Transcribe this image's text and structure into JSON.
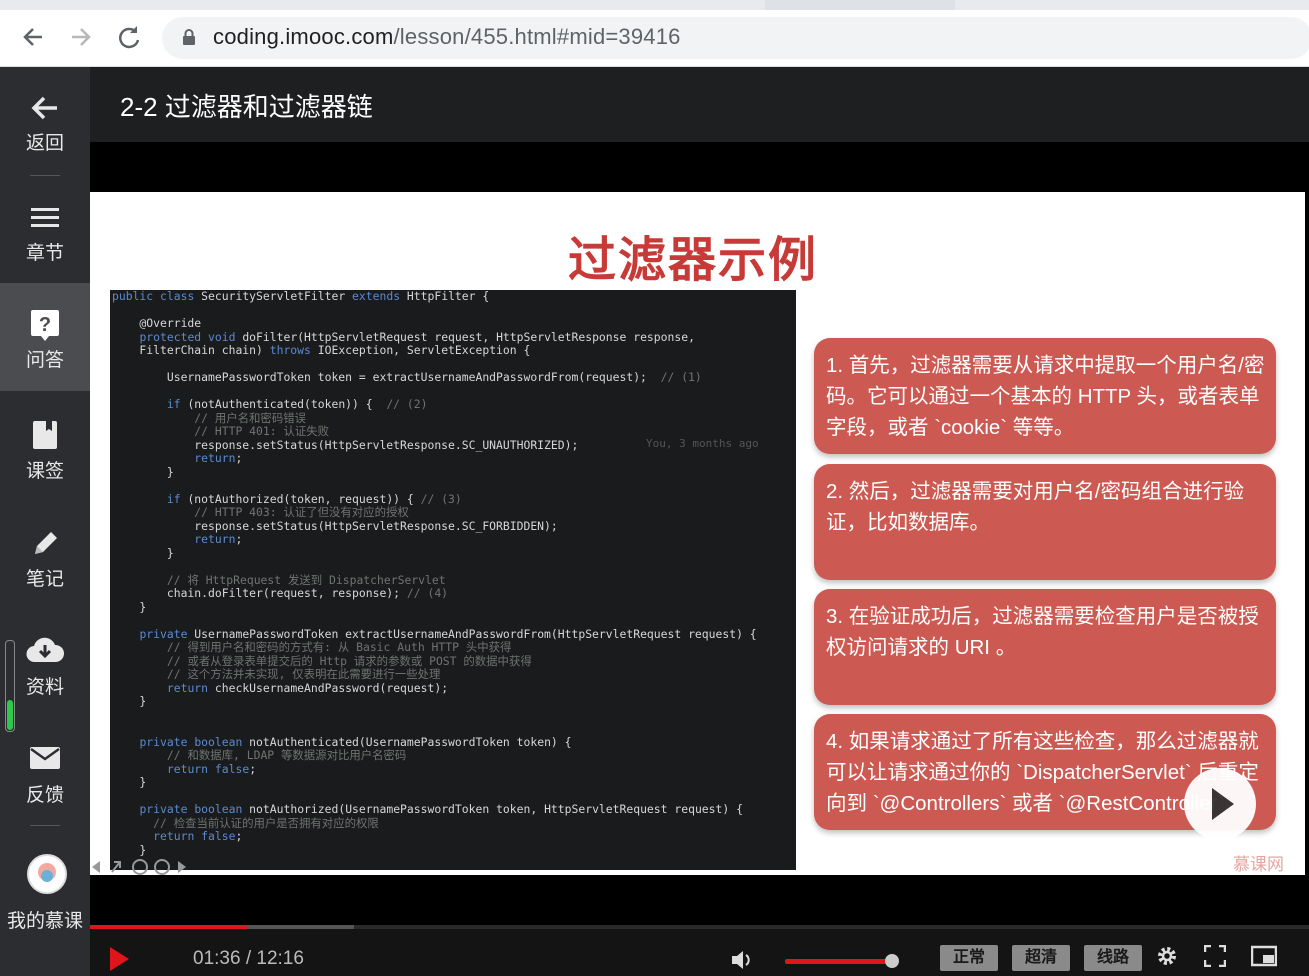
{
  "browser": {
    "url_host": "coding.imooc.com",
    "url_path": "/lesson/455.html#mid=39416"
  },
  "sidebar": {
    "items": [
      {
        "label": "返回",
        "icon": "back-arrow-icon"
      },
      {
        "label": "章节",
        "icon": "list-icon"
      },
      {
        "label": "问答",
        "icon": "question-icon"
      },
      {
        "label": "课签",
        "icon": "bookmark-icon"
      },
      {
        "label": "笔记",
        "icon": "pencil-icon"
      },
      {
        "label": "资料",
        "icon": "cloud-download-icon"
      },
      {
        "label": "反馈",
        "icon": "mail-icon"
      },
      {
        "label": "我的慕课",
        "icon": "avatar"
      }
    ],
    "active": "问答"
  },
  "header": {
    "title": "2-2 过滤器和过滤器链"
  },
  "slide": {
    "title": "过滤器示例",
    "code_lines": [
      "public class SecurityServletFilter extends HttpFilter {",
      "",
      "    @Override",
      "    protected void doFilter(HttpServletRequest request, HttpServletResponse response,",
      "    FilterChain chain) throws IOException, ServletException {",
      "",
      "        UsernamePasswordToken token = extractUsernameAndPasswordFrom(request);  // (1)",
      "",
      "        if (notAuthenticated(token)) {  // (2)",
      "            // 用户名和密码错误",
      "            // HTTP 401: 认证失败",
      "            response.setStatus(HttpServletResponse.SC_UNAUTHORIZED);",
      "            return;",
      "        }",
      "",
      "        if (notAuthorized(token, request)) { // (3)",
      "            // HTTP 403: 认证了但没有对应的授权",
      "            response.setStatus(HttpServletResponse.SC_FORBIDDEN);",
      "            return;",
      "        }",
      "",
      "        // 将 HttpRequest 发送到 DispatcherServlet",
      "        chain.doFilter(request, response); // (4)",
      "    }",
      "",
      "    private UsernamePasswordToken extractUsernameAndPasswordFrom(HttpServletRequest request) {",
      "        // 得到用户名和密码的方式有: 从 Basic Auth HTTP 头中获得",
      "        // 或者从登录表单提交后的 Http 请求的参数或 POST 的数据中获得",
      "        // 这个方法并未实现, 仅表明在此需要进行一些处理",
      "        return checkUsernameAndPassword(request);",
      "    }",
      "",
      "",
      "    private boolean notAuthenticated(UsernamePasswordToken token) {",
      "        // 和数据库, LDAP 等数据源对比用户名密码",
      "        return false;",
      "    }",
      "",
      "    private boolean notAuthorized(UsernamePasswordToken token, HttpServletRequest request) {",
      "      // 检查当前认证的用户是否拥有对应的权限",
      "      return false;",
      "    }"
    ],
    "blame": "You, 3 months ago",
    "bullets": [
      "1. 首先，过滤器需要从请求中提取一个用户名/密码。它可以通过一个基本的 HTTP 头，或者表单字段，或者 `cookie` 等等。",
      "2. 然后，过滤器需要对用户名/密码组合进行验证，比如数据库。",
      "3. 在验证成功后，过滤器需要检查用户是否被授权访问请求的 URI 。",
      "4. 如果请求通过了所有这些检查，那么过滤器就可以让请求通过你的 `DispatcherServlet` 后重定向到 `@Controllers` 或者 `@RestController`。"
    ],
    "watermark": "慕课网"
  },
  "player": {
    "time": "01:36 / 12:16",
    "progress": 0.13,
    "volume": 0.85,
    "buttons": [
      "正常",
      "超清",
      "线路"
    ]
  }
}
